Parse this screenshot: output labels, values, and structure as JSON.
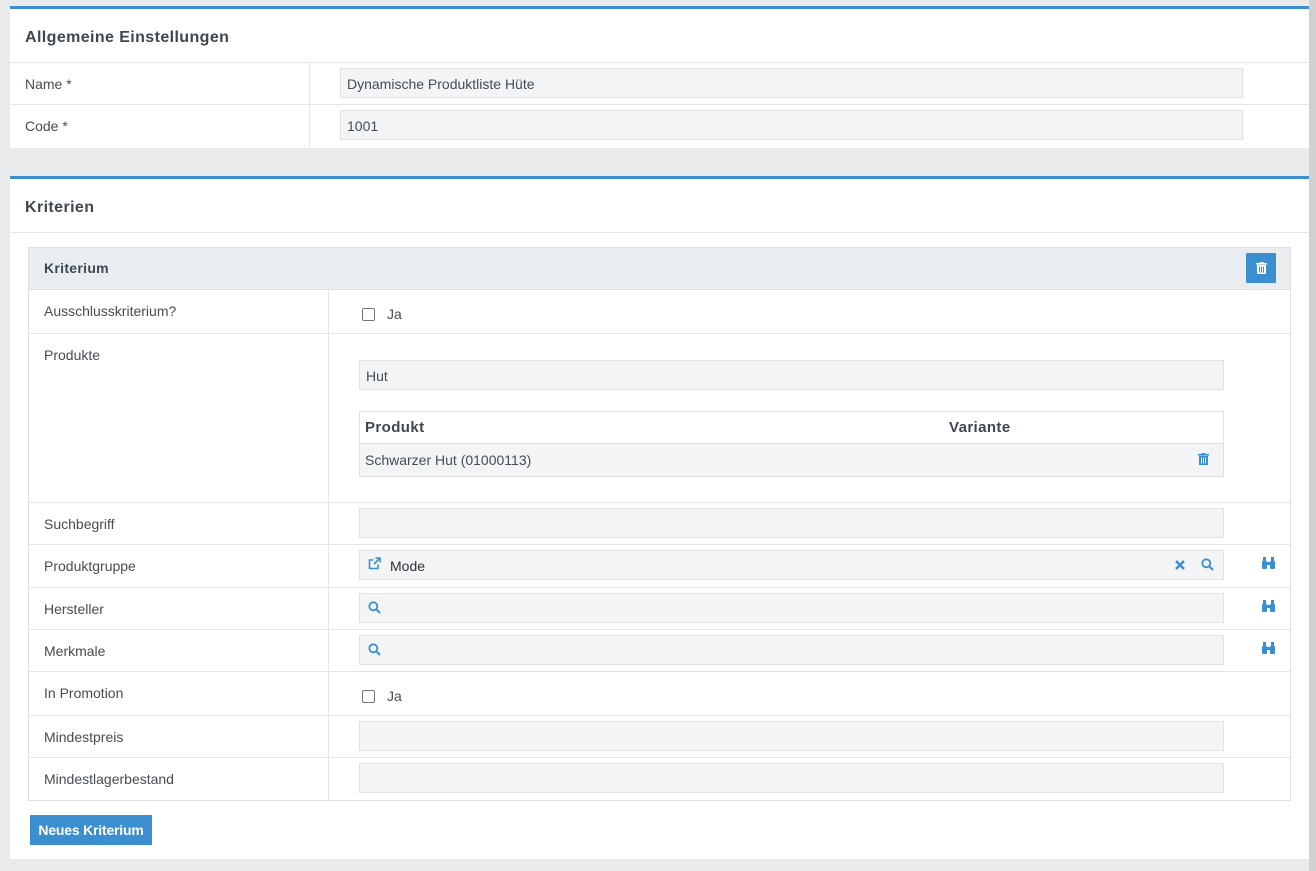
{
  "general": {
    "title": "Allgemeine Einstellungen",
    "name_label": "Name *",
    "name_value": "Dynamische Produktliste Hüte",
    "code_label": "Code *",
    "code_value": "1001"
  },
  "criteria": {
    "title": "Kriterien",
    "criterion_title": "Kriterium",
    "exclusion_label": "Ausschlusskriterium?",
    "exclusion_checkbox_label": "Ja",
    "products_label": "Produkte",
    "products_search_value": "Hut",
    "products_table": {
      "columns": [
        "Produkt",
        "Variante"
      ],
      "rows": [
        {
          "product": "Schwarzer Hut (01000113)",
          "variant": ""
        }
      ]
    },
    "search_term_label": "Suchbegriff",
    "search_term_value": "",
    "product_group_label": "Produktgruppe",
    "product_group_value": "Mode",
    "manufacturer_label": "Hersteller",
    "manufacturer_value": "",
    "features_label": "Merkmale",
    "features_value": "",
    "promotion_label": "In Promotion",
    "promotion_checkbox_label": "Ja",
    "min_price_label": "Mindestpreis",
    "min_price_value": "",
    "min_stock_label": "Mindestlagerbestand",
    "min_stock_value": "",
    "new_criterion_button": "Neues Kriterium"
  },
  "colors": {
    "accent": "#3b8fd1",
    "background": "#e9eaeb"
  }
}
